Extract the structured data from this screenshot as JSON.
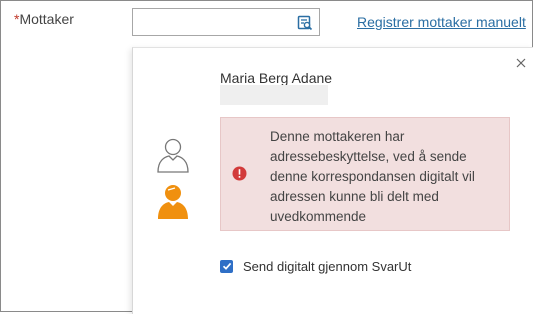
{
  "field": {
    "required_marker": "*",
    "label": "Mottaker"
  },
  "search": {
    "value": "",
    "icon": "address-book-search-icon"
  },
  "manual_link": "Registrer mottaker manuelt",
  "popup": {
    "recipient_name": "Maria Berg Adane",
    "warning": "Denne mottakeren har adressebeskyttelse, ved å sende denne korrespondansen digitalt vil adressen kunne bli delt med uvedkommende",
    "checkbox_label": "Send digitalt gjennom SvarUt",
    "checkbox_checked": true
  },
  "colors": {
    "link": "#2a6ea3",
    "warning_bg": "#f2dfdf",
    "alert": "#d23b3b",
    "avatar": "#f0900f",
    "checkbox": "#2f6fc6"
  }
}
